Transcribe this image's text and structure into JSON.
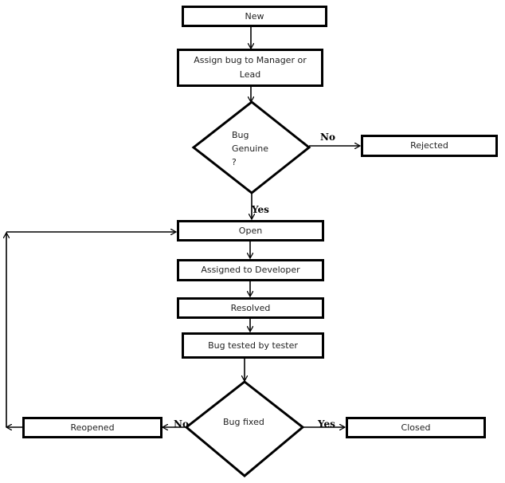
{
  "flowchart": {
    "nodes": {
      "new": "New",
      "assign": "Assign bug to Manager or Lead",
      "genuine_q": [
        "Bug",
        "Genuine",
        "?"
      ],
      "rejected": "Rejected",
      "open": "Open",
      "assigned_dev": "Assigned to Developer",
      "resolved": "Resolved",
      "tested": "Bug tested by tester",
      "fixed_q": "Bug fixed",
      "reopened": "Reopened",
      "closed": "Closed"
    },
    "edge_labels": {
      "genuine_no": "No",
      "genuine_yes": "Yes",
      "fixed_no": "No",
      "fixed_yes": "Yes"
    },
    "edges": [
      [
        "New",
        "Assign bug to Manager or Lead"
      ],
      [
        "Assign bug to Manager or Lead",
        "Bug Genuine ?"
      ],
      [
        "Bug Genuine ?",
        "Rejected",
        "No"
      ],
      [
        "Bug Genuine ?",
        "Open",
        "Yes"
      ],
      [
        "Open",
        "Assigned to Developer"
      ],
      [
        "Assigned to Developer",
        "Resolved"
      ],
      [
        "Resolved",
        "Bug tested by tester"
      ],
      [
        "Bug tested by tester",
        "Bug fixed"
      ],
      [
        "Bug fixed",
        "Reopened",
        "No"
      ],
      [
        "Bug fixed",
        "Closed",
        "Yes"
      ],
      [
        "Reopened",
        "Open"
      ]
    ]
  }
}
